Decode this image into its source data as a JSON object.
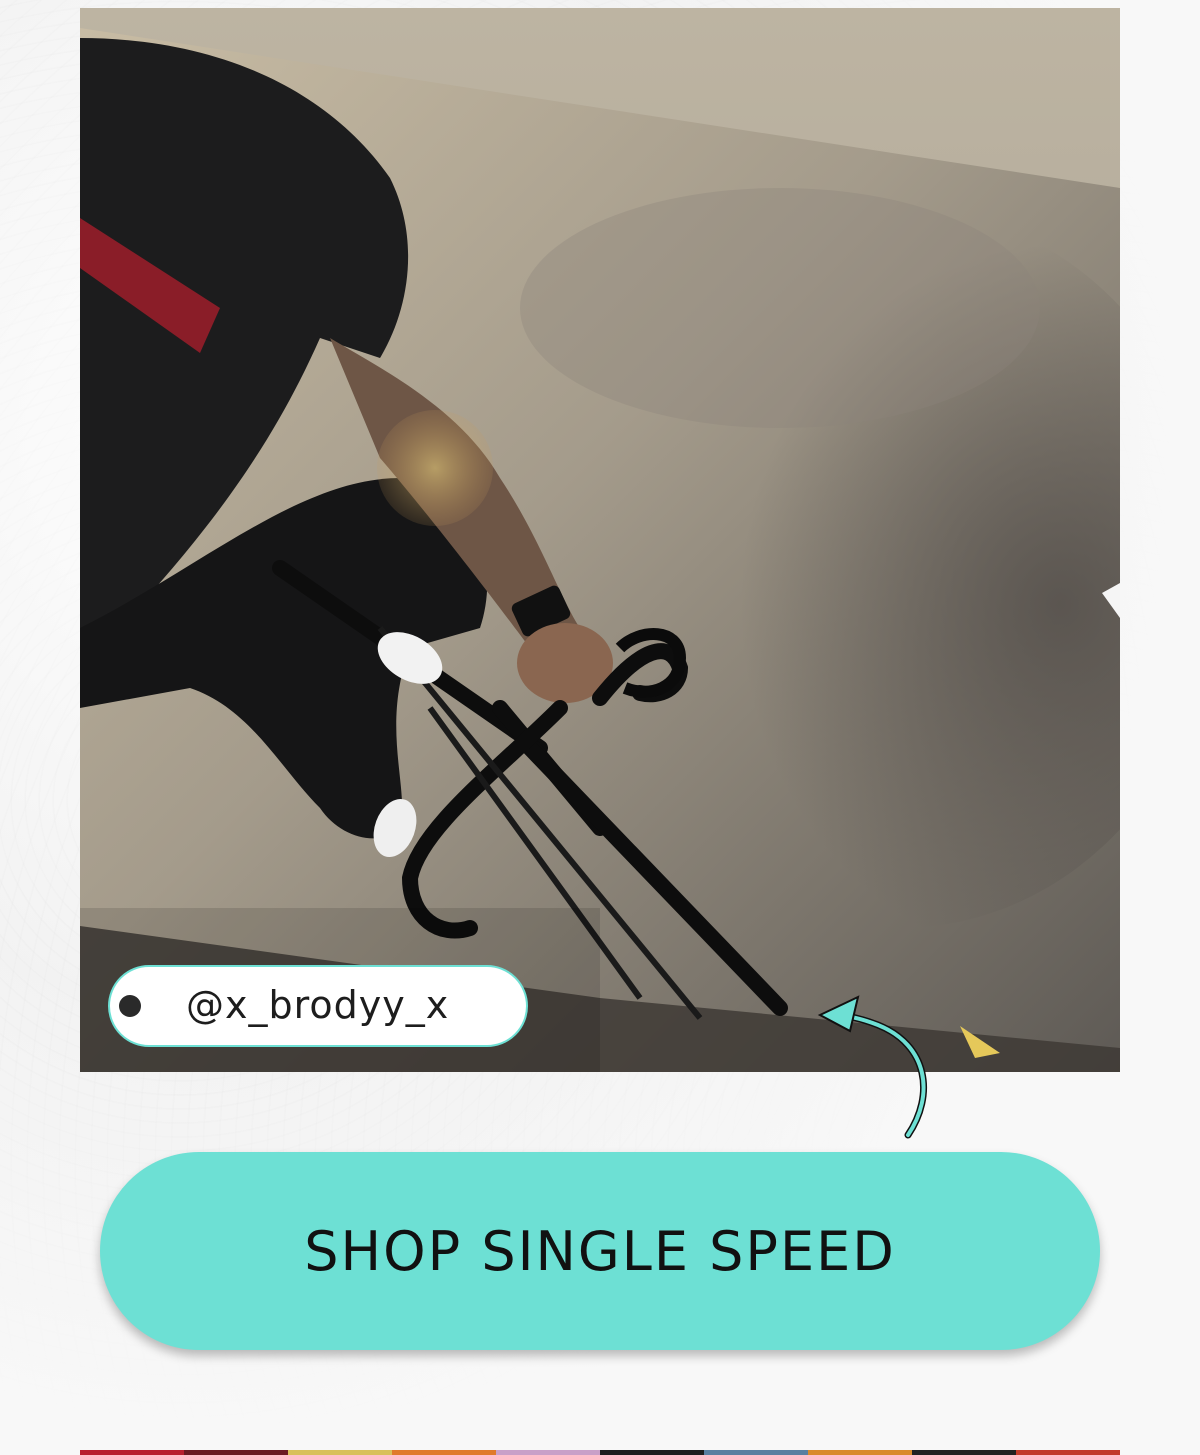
{
  "photo": {
    "description_icon": "cyclist-photo",
    "handle": "@x_brodyy_x"
  },
  "cta": {
    "label": "SHOP SINGLE SPEED"
  },
  "colors": {
    "accent": "#6de0d4",
    "text": "#111111",
    "background": "#f6f6f6"
  },
  "strip_colors": [
    "#b8202f",
    "#6a1a22",
    "#d8c05a",
    "#e07a2a",
    "#c9a0c8",
    "#1e1e1e",
    "#5a7fa0",
    "#d98a2a",
    "#222222",
    "#c23a2a"
  ]
}
